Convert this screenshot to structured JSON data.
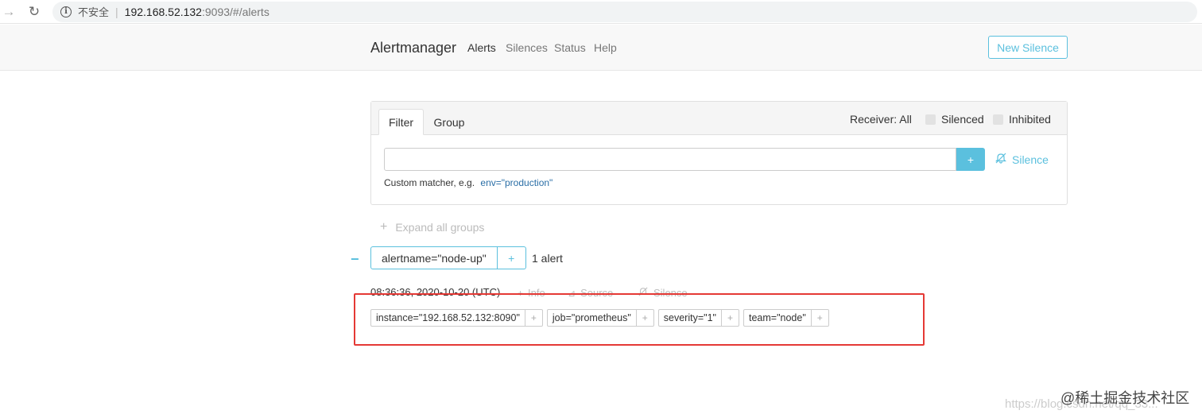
{
  "browser": {
    "security_label": "不安全",
    "url_host": "192.168.52.132",
    "url_rest": ":9093/#/alerts"
  },
  "navbar": {
    "brand": "Alertmanager",
    "links": [
      "Alerts",
      "Silences",
      "Status",
      "Help"
    ],
    "new_silence": "New Silence"
  },
  "filter": {
    "tabs": [
      "Filter",
      "Group"
    ],
    "receiver": "Receiver: All",
    "silenced": "Silenced",
    "inhibited": "Inhibited",
    "input_value": "",
    "add_label": "+",
    "silence_link": "Silence",
    "hint_prefix": "Custom matcher, e.g.",
    "hint_example": "env=\"production\""
  },
  "expand_all": "Expand all groups",
  "group": {
    "label": "alertname=\"node-up\"",
    "plus": "+",
    "count": "1 alert"
  },
  "alert": {
    "time": "08:36:36, 2020-10-20 (UTC)",
    "info": "Info",
    "source": "Source",
    "silence": "Silence",
    "labels": [
      "instance=\"192.168.52.132:8090\"",
      "job=\"prometheus\"",
      "severity=\"1\"",
      "team=\"node\""
    ]
  },
  "watermark": "@稀土掘金技术社区",
  "watermark_url": "https://blog.csdn.net/qq_33...",
  "colors": {
    "accent": "#5bc0de",
    "highlight": "#e53935"
  }
}
